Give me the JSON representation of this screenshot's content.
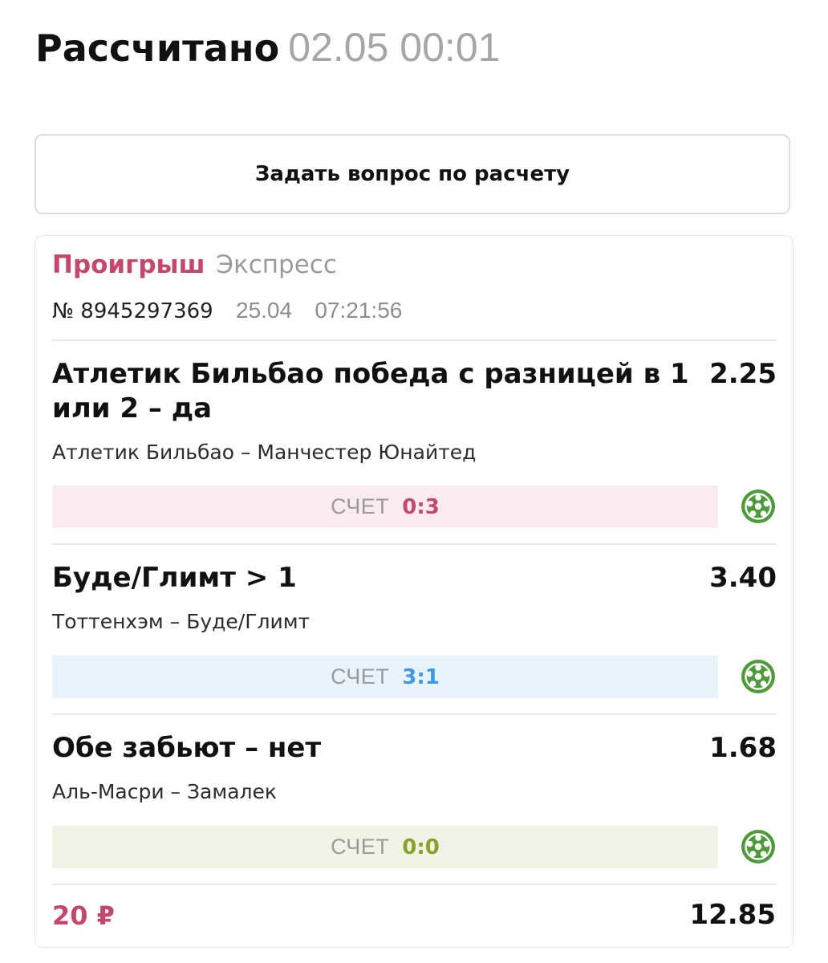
{
  "header": {
    "title": "Рассчитано",
    "datetime": "02.05 00:01"
  },
  "ask_button": {
    "label": "Задать вопрос по расчету"
  },
  "bet": {
    "result": "Проигрыш",
    "type": "Экспресс",
    "number": "№ 8945297369",
    "date": "25.04",
    "time": "07:21:56",
    "events": [
      {
        "selection": "Атлетик Бильбао победа с разницей в 1 или 2 – да",
        "odds": "2.25",
        "match": "Атлетик Бильбао – Манчестер Юнайтед",
        "score_label": "СЧЕТ",
        "score": "0:3",
        "score_color": "#c3486c",
        "score_bg": "#f9ebef",
        "icon": "soccer-ball-icon"
      },
      {
        "selection": "Буде/Глимт > 1",
        "odds": "3.40",
        "match": "Тоттенхэм – Буде/Глимт",
        "score_label": "СЧЕТ",
        "score": "3:1",
        "score_color": "#3d9ae0",
        "score_bg": "#e8f3fc",
        "icon": "soccer-ball-icon"
      },
      {
        "selection": "Обе забьют – нет",
        "odds": "1.68",
        "match": "Аль-Масри – Замалек",
        "score_label": "СЧЕТ",
        "score": "0:0",
        "score_color": "#8aa12a",
        "score_bg": "#f1f3e7",
        "icon": "soccer-ball-icon"
      }
    ],
    "stake": "20 ₽",
    "total_odds": "12.85"
  },
  "colors": {
    "loss": "#c3486c",
    "icon_green": "#4c9a3a"
  }
}
